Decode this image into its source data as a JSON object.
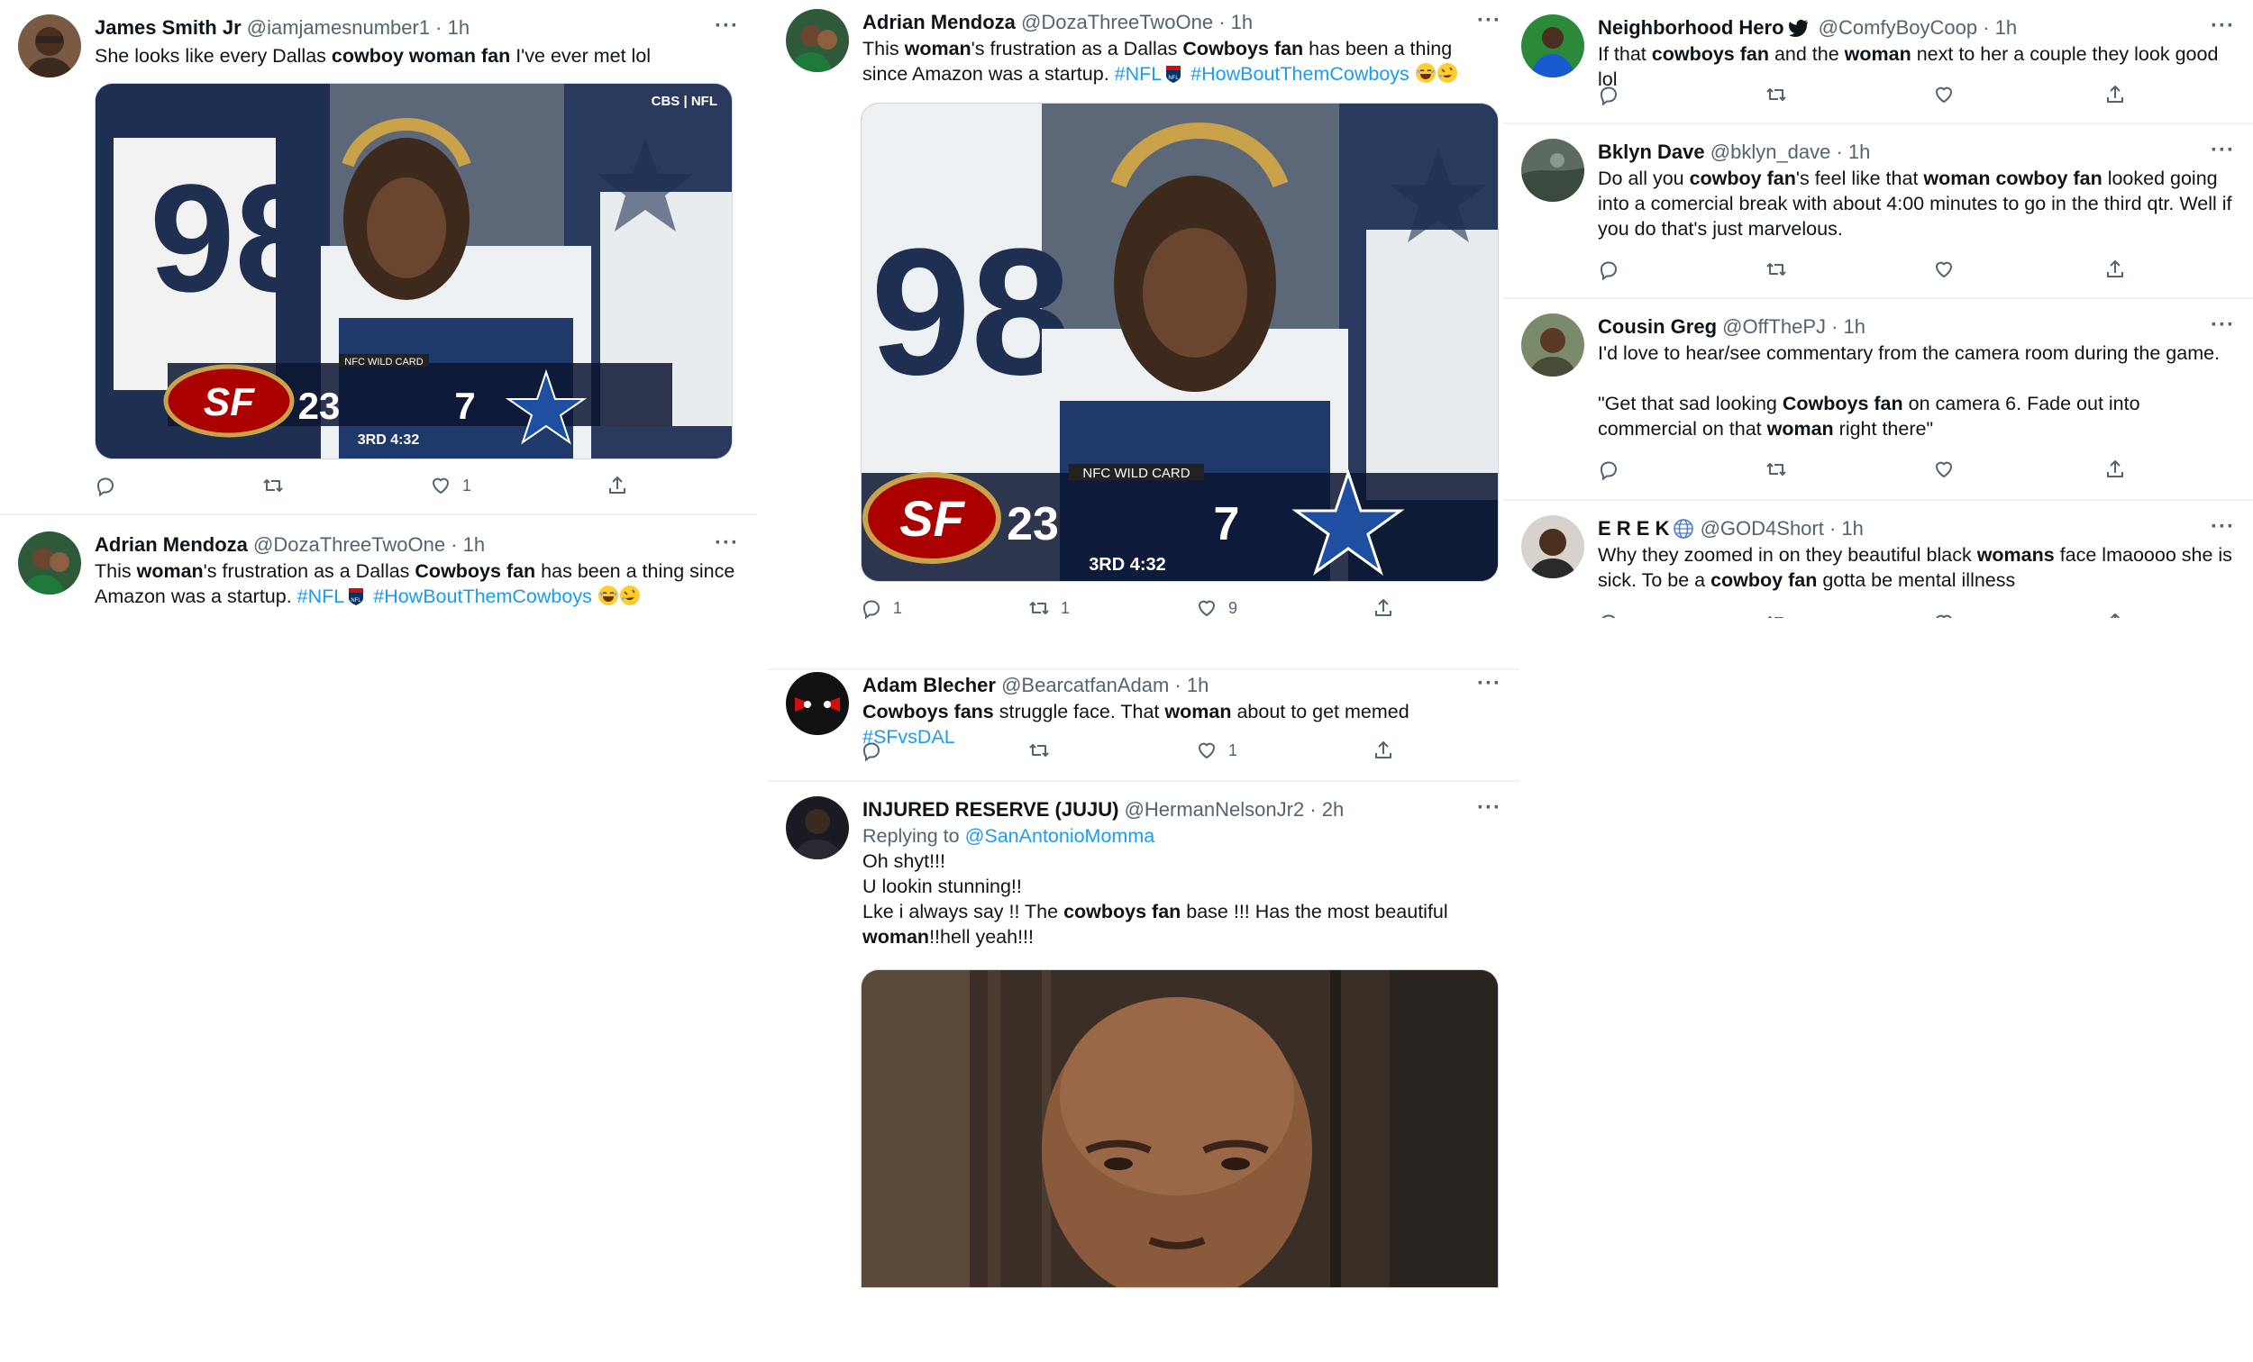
{
  "col1": {
    "t1": {
      "name": "James Smith Jr",
      "handle": "@iamjamesnumber1 · 1h",
      "more": "···",
      "text_parts": [
        "She looks like every Dallas ",
        "cowboy woman fan",
        " I've ever met lol"
      ],
      "stats": {
        "reply": "",
        "retweet": "",
        "like": "1"
      },
      "score": {
        "home": "23",
        "away": "7",
        "label": "NFC WILD CARD",
        "time": "3RD 4:32",
        "network": "CBS | NFL"
      }
    },
    "t2": {
      "name": "Adrian Mendoza",
      "handle": "@DozaThreeTwoOne · 1h",
      "more": "···",
      "text_parts": [
        "This ",
        "woman",
        "'s frustration as a Dallas ",
        "Cowboys fan",
        " has been a thing since Amazon was a startup. "
      ],
      "tag1": "#NFL",
      "tag2": "#HowBoutThemCowboys"
    }
  },
  "col2": {
    "t1": {
      "name": "Adrian Mendoza",
      "handle": "@DozaThreeTwoOne · 1h",
      "more": "···",
      "text_parts": [
        "This ",
        "woman",
        "'s frustration as a Dallas ",
        "Cowboys fan",
        " has been a thing since Amazon was a startup. "
      ],
      "tag1": "#NFL",
      "tag2": "#HowBoutThemCowboys",
      "stats": {
        "reply": "1",
        "retweet": "1",
        "like": "9"
      },
      "score": {
        "home": "23",
        "away": "7",
        "label": "NFC WILD CARD",
        "time": "3RD 4:32"
      }
    },
    "t2": {
      "name": "Adam Blecher",
      "handle": "@BearcatfanAdam · 1h",
      "more": "···",
      "text_parts": [
        "Cowboys fans",
        " struggle face. That ",
        "woman",
        " about to get memed "
      ],
      "tag": "#SFvsDAL",
      "stats": {
        "reply": "",
        "retweet": "",
        "like": "1"
      }
    },
    "t3": {
      "name": "INJURED RESERVE (JUJU)",
      "handle": "@HermanNelsonJr2 · 2h",
      "more": "···",
      "replying": "Replying to",
      "replying_to": "@SanAntonioMomma",
      "line1": "Oh shyt!!!",
      "line2": "U lookin stunning!!",
      "line3_parts": [
        "Lke i always say !! The ",
        "cowboys fan",
        " base !!! Has the most beautiful"
      ],
      "line4_parts": [
        "woman",
        "!!hell yeah!!!"
      ]
    }
  },
  "col3": {
    "t1": {
      "name": "Neighborhood Hero",
      "handle": "@ComfyBoyCoop · 1h",
      "more": "···",
      "text_parts": [
        "If that ",
        "cowboys fan",
        " and the ",
        "woman",
        " next to her a couple they look good lol"
      ]
    },
    "t2": {
      "name": "Bklyn Dave",
      "handle": "@bklyn_dave · 1h",
      "more": "···",
      "text_parts": [
        "Do all you ",
        "cowboy fan",
        "'s feel like that ",
        "woman cowboy fan",
        " looked going into a comercial break with about 4:00 minutes to go in the third qtr. Well if you do that's just marvelous."
      ]
    },
    "t3": {
      "name": "Cousin Greg",
      "handle": "@OffThePJ · 1h",
      "more": "···",
      "line1": "I'd love to hear/see commentary from the camera room during the game.",
      "line2_parts": [
        "\"Get that sad looking ",
        "Cowboys fan",
        " on camera 6. Fade out into commercial on that ",
        "woman",
        " right there\""
      ]
    },
    "t4": {
      "name": "E R E K",
      "handle": "@GOD4Short · 1h",
      "more": "···",
      "text_parts": [
        "Why they zoomed in on they beautiful black ",
        "womans",
        " face lmaoooo she is sick. To be a ",
        "cowboy fan",
        " gotta be mental illness"
      ]
    }
  },
  "icons": [
    "reply-icon",
    "retweet-icon",
    "like-icon",
    "share-icon",
    "more-icon"
  ],
  "colors": {
    "accent": "#1d9bf0",
    "muted": "#536471",
    "text": "#0f1419",
    "divider": "#eff3f4"
  }
}
